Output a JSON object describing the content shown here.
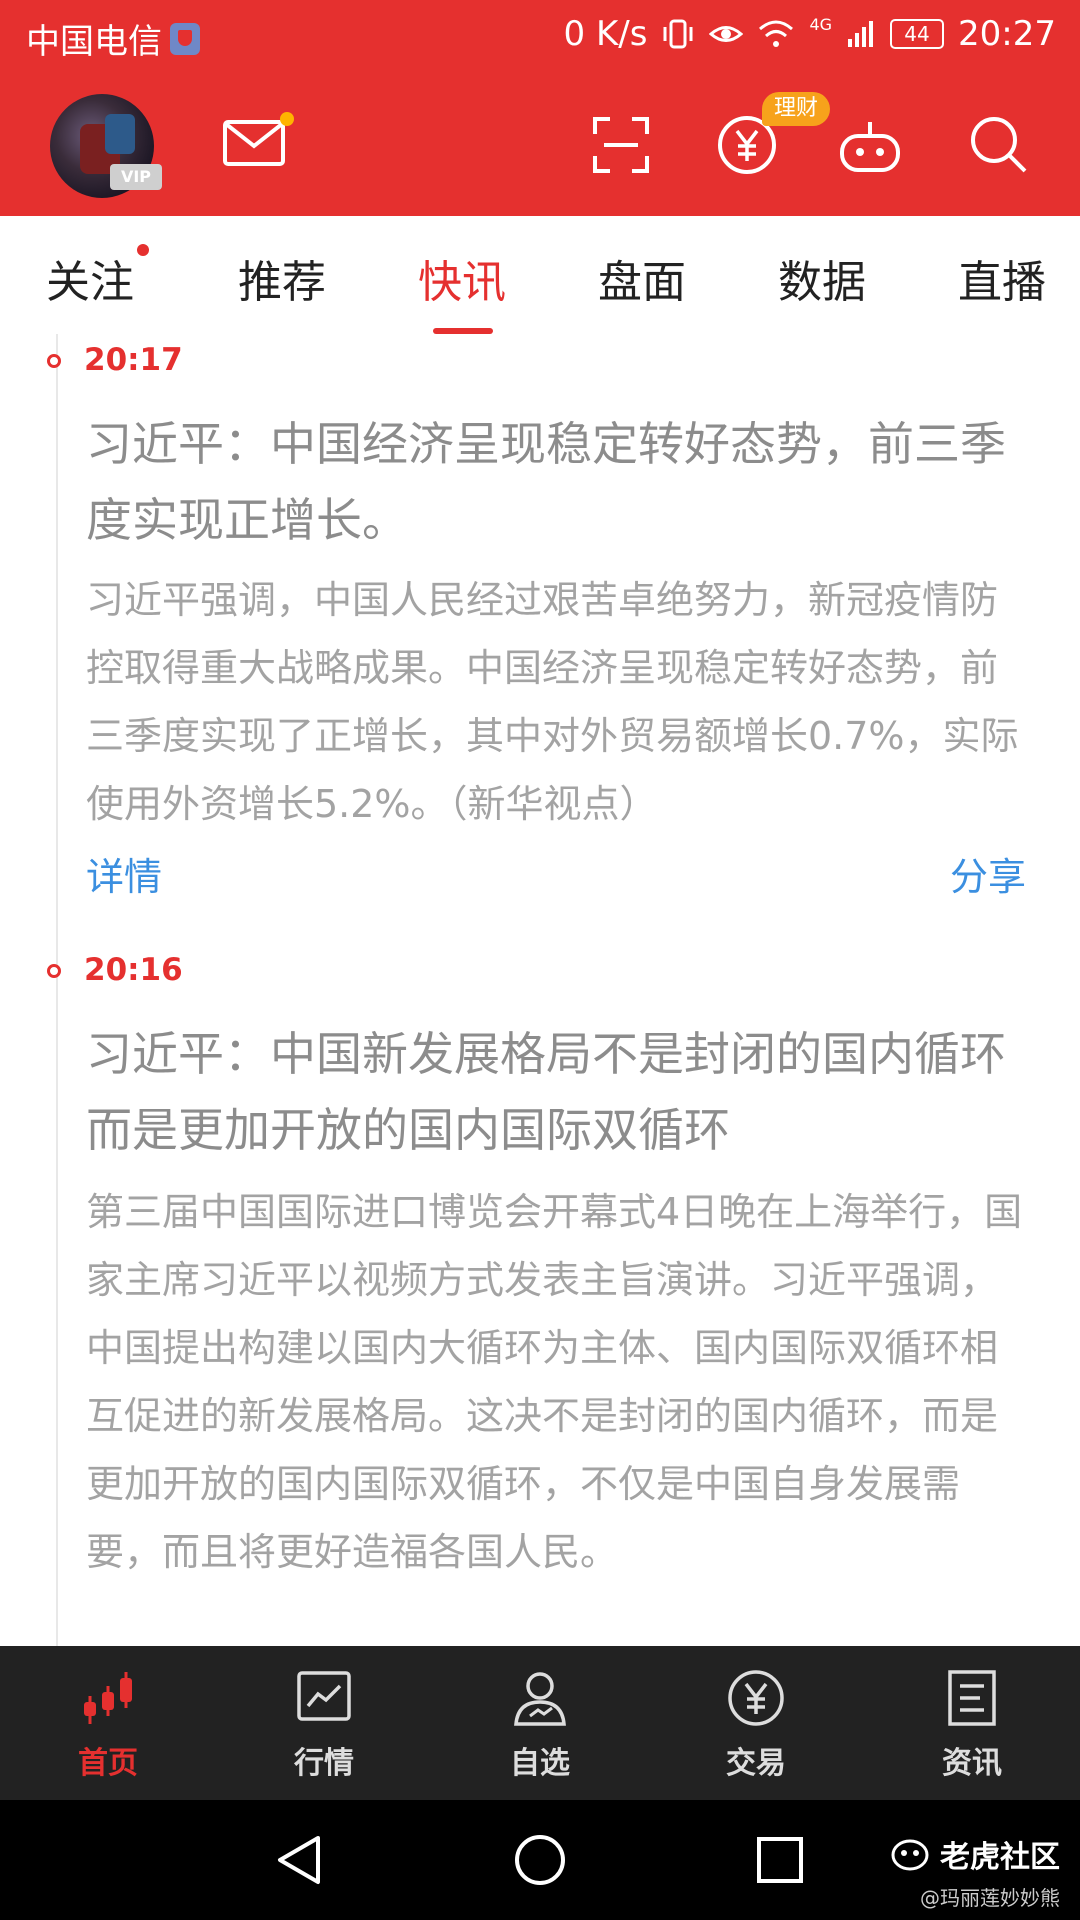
{
  "status_bar": {
    "carrier": "中国电信",
    "net_speed": "0 K/s",
    "network_type": "4G",
    "battery": "44",
    "time": "20:27"
  },
  "header": {
    "vip_label": "VIP",
    "licai_badge": "理财",
    "icons": [
      "mail-icon",
      "scan-icon",
      "yuan-icon",
      "robot-icon",
      "search-icon"
    ]
  },
  "tabs": [
    {
      "label": "关注",
      "active": false,
      "has_dot": true
    },
    {
      "label": "推荐",
      "active": false
    },
    {
      "label": "快讯",
      "active": true
    },
    {
      "label": "盘面",
      "active": false
    },
    {
      "label": "数据",
      "active": false
    },
    {
      "label": "直播",
      "active": false
    }
  ],
  "news": [
    {
      "time": "20:17",
      "headline": "习近平：中国经济呈现稳定转好态势，前三季度实现正增长。",
      "body": "习近平强调，中国人民经过艰苦卓绝努力，新冠疫情防控取得重大战略成果。中国经济呈现稳定转好态势，前三季度实现了正增长，其中对外贸易额增长0.7%，实际使用外资增长5.2%。（新华视点）",
      "detail_label": "详情",
      "share_label": "分享"
    },
    {
      "time": "20:16",
      "headline": "习近平：中国新发展格局不是封闭的国内循环 而是更加开放的国内国际双循环",
      "body": "第三届中国国际进口博览会开幕式4日晚在上海举行，国家主席习近平以视频方式发表主旨演讲。习近平强调，中国提出构建以国内大循环为主体、国内国际双循环相互促进的新发展格局。这决不是封闭的国内循环，而是更加开放的国内国际双循环，不仅是中国自身发展需要，而且将更好造福各国人民。"
    }
  ],
  "bottom_nav": [
    {
      "label": "首页",
      "icon": "candlestick-icon",
      "active": true
    },
    {
      "label": "行情",
      "icon": "chart-icon",
      "active": false
    },
    {
      "label": "自选",
      "icon": "user-icon",
      "active": false
    },
    {
      "label": "交易",
      "icon": "yuan-icon",
      "active": false
    },
    {
      "label": "资讯",
      "icon": "document-icon",
      "active": false
    }
  ],
  "watermark": {
    "title": "老虎社区",
    "author": "@玛丽莲妙妙熊"
  },
  "colors": {
    "brand_red": "#e5302f",
    "link_blue": "#3b8fe0",
    "badge_orange": "#f7a21b"
  }
}
